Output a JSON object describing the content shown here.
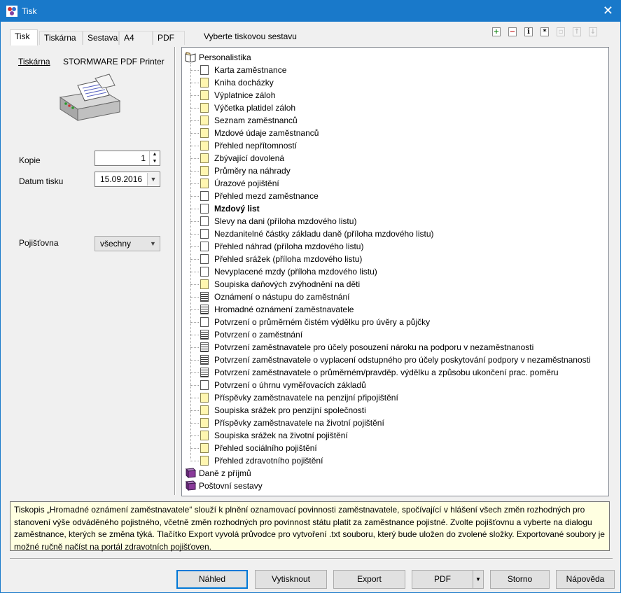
{
  "window": {
    "title": "Tisk"
  },
  "tabs": [
    "Tisk",
    "Tiskárna",
    "Sestava",
    "A4",
    "PDF"
  ],
  "panel_label": "Vyberte tiskovou sestavu",
  "toolbar": {
    "icons": [
      "add-icon",
      "remove-icon",
      "info-icon",
      "star-icon",
      "copy-icon",
      "move-up-icon",
      "move-down-icon"
    ]
  },
  "left": {
    "printer_label": "Tiskárna",
    "printer_name": "STORMWARE PDF Printer",
    "copies_label": "Kopie",
    "copies_value": "1",
    "date_label": "Datum tisku",
    "date_value": "15.09.2016",
    "insurer_label": "Pojišťovna",
    "insurer_value": "všechny"
  },
  "tree": {
    "root": "Personalistika",
    "items": [
      {
        "label": "Karta zaměstnance",
        "icon": "white"
      },
      {
        "label": "Kniha docházky",
        "icon": "yellow"
      },
      {
        "label": "Výplatnice záloh",
        "icon": "yellow"
      },
      {
        "label": "Výčetka platidel záloh",
        "icon": "yellow"
      },
      {
        "label": "Seznam zaměstnanců",
        "icon": "yellow"
      },
      {
        "label": "Mzdové údaje zaměstnanců",
        "icon": "yellow"
      },
      {
        "label": "Přehled nepřítomností",
        "icon": "yellow"
      },
      {
        "label": "Zbývající dovolená",
        "icon": "yellow"
      },
      {
        "label": "Průměry na náhrady",
        "icon": "yellow"
      },
      {
        "label": "Úrazové pojištění",
        "icon": "yellow"
      },
      {
        "label": "Přehled mezd zaměstnance",
        "icon": "white"
      },
      {
        "label": "Mzdový list",
        "icon": "white",
        "bold": true
      },
      {
        "label": "Slevy na dani (příloha mzdového listu)",
        "icon": "white"
      },
      {
        "label": "Nezdanitelné částky základu daně (příloha mzdového listu)",
        "icon": "white"
      },
      {
        "label": "Přehled náhrad (příloha mzdového listu)",
        "icon": "white"
      },
      {
        "label": "Přehled srážek (příloha mzdového listu)",
        "icon": "white"
      },
      {
        "label": "Nevyplacené mzdy (příloha mzdového listu)",
        "icon": "white"
      },
      {
        "label": "Soupiska daňových zvýhodnění na děti",
        "icon": "yellow"
      },
      {
        "label": "Oznámení o nástupu do zaměstnání",
        "icon": "dark"
      },
      {
        "label": "Hromadné oznámení zaměstnavatele",
        "icon": "dark"
      },
      {
        "label": "Potvrzení o průměrném čistém výdělku pro úvěry a půjčky",
        "icon": "white"
      },
      {
        "label": "Potvrzení o zaměstnání",
        "icon": "dark"
      },
      {
        "label": "Potvrzení zaměstnavatele pro účely posouzení nároku na podporu v nezaměstnanosti",
        "icon": "dark"
      },
      {
        "label": "Potvrzení zaměstnavatele o vyplacení odstupného pro účely poskytování podpory v nezaměstnanosti",
        "icon": "dark"
      },
      {
        "label": "Potvrzení zaměstnavatele o průměrném/pravděp. výdělku a způsobu ukončení prac. poměru",
        "icon": "dark"
      },
      {
        "label": "Potvrzení o úhrnu vyměřovacích základů",
        "icon": "white"
      },
      {
        "label": "Příspěvky zaměstnavatele na penzijní připojištění",
        "icon": "yellow"
      },
      {
        "label": "Soupiska srážek pro penzijní společnosti",
        "icon": "yellow"
      },
      {
        "label": "Příspěvky zaměstnavatele na životní pojištění",
        "icon": "yellow"
      },
      {
        "label": "Soupiska srážek na životní pojištění",
        "icon": "yellow"
      },
      {
        "label": "Přehled sociálního pojištění",
        "icon": "yellow"
      },
      {
        "label": "Přehled zdravotního pojištění",
        "icon": "yellow"
      }
    ],
    "groups": [
      "Daně z příjmů",
      "Poštovní sestavy"
    ]
  },
  "info_text": "Tiskopis „Hromadné oznámení zaměstnavatele“ slouží k plnění oznamovací povinnosti zaměstnavatele, spočívající v hlášení všech změn rozhodných pro stanovení výše odváděného pojistného, včetně změn rozhodných pro povinnost státu platit za zaměstnance pojistné. Zvolte pojišťovnu a vyberte na dialogu zaměstnance, kterých se změna týká. Tlačítko Export vyvolá průvodce pro vytvoření .txt souboru, který bude uložen do zvolené složky. Exportované soubory je možné ručně načíst na portál zdravotních pojišťoven.",
  "buttons": {
    "preview": "Náhled",
    "print": "Vytisknout",
    "export": "Export",
    "pdf": "PDF",
    "cancel": "Storno",
    "help": "Nápověda"
  },
  "colors": {
    "titlebar": "#1979ca",
    "info_bg": "#ffffe1",
    "default_button_border": "#0078d7"
  }
}
